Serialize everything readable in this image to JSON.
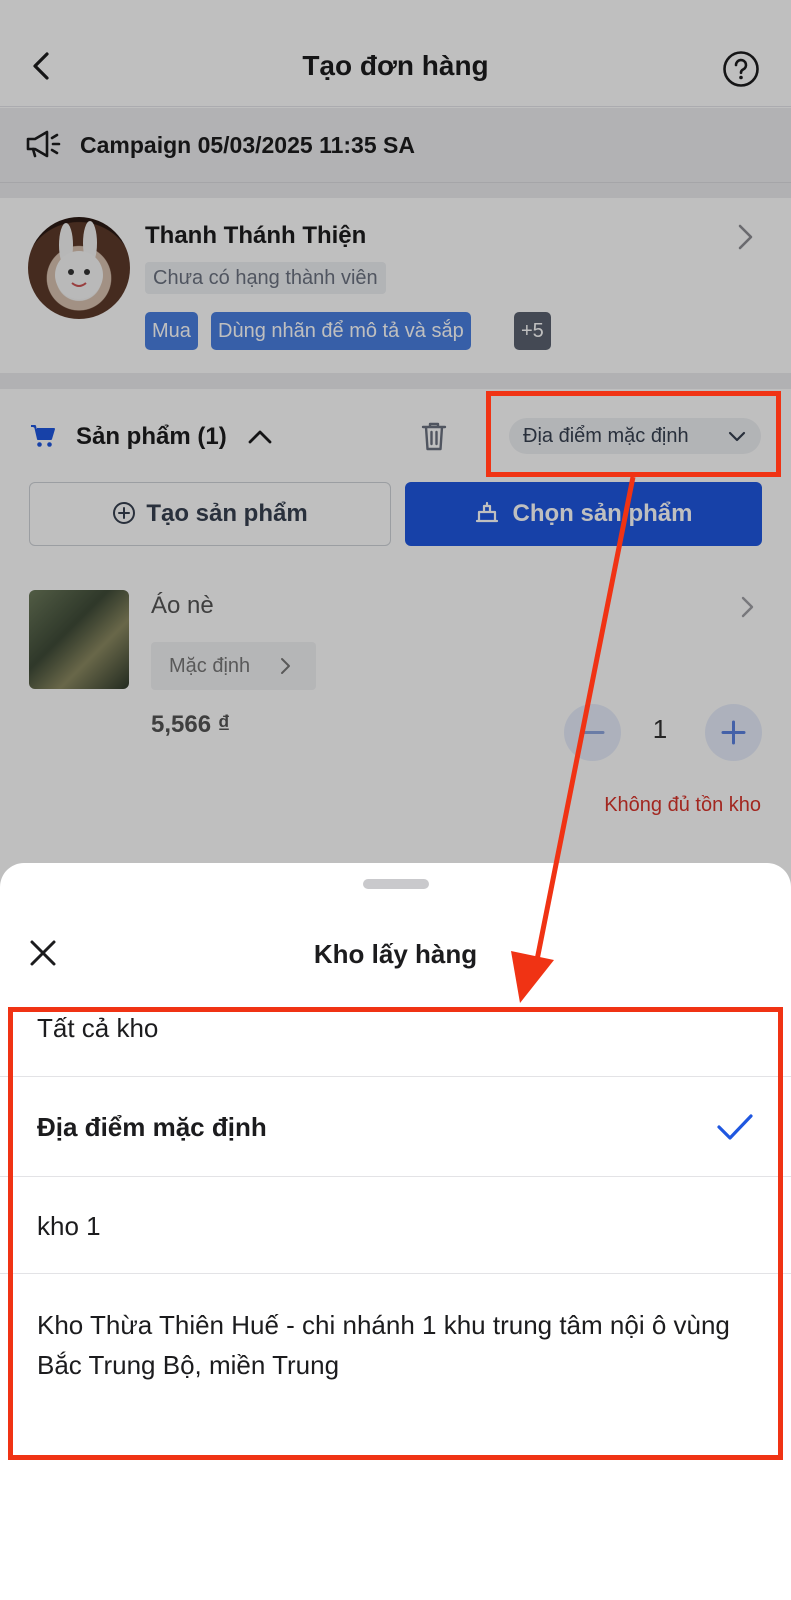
{
  "header": {
    "title": "Tạo đơn hàng"
  },
  "campaign": {
    "label": "Campaign 05/03/2025 11:35 SA"
  },
  "customer": {
    "name": "Thanh Thánh Thiện",
    "rank": "Chưa có hạng thành viên",
    "tags": [
      "Mua",
      "Dùng nhãn để mô tả và sắp",
      "+5"
    ]
  },
  "products": {
    "title": "Sản phẩm (1)",
    "location_dropdown": "Địa điểm mặc định",
    "create_button": "Tạo sản phẩm",
    "choose_button": "Chọn sản phẩm",
    "item": {
      "name": "Áo nè",
      "variant": "Mặc định",
      "price": "5,566 ₫",
      "quantity": "1",
      "warning": "Không đủ tồn kho"
    }
  },
  "sheet": {
    "title": "Kho lấy hàng",
    "options": [
      {
        "label": "Tất cả kho",
        "selected": false
      },
      {
        "label": "Địa điểm mặc định",
        "selected": true
      },
      {
        "label": "kho 1",
        "selected": false
      },
      {
        "label": "Kho Thừa Thiên Huế - chi nhánh 1 khu trung tâm nội ô vùng Bắc Trung Bộ, miền Trung",
        "selected": false
      }
    ]
  },
  "colors": {
    "primary": "#1f57e0",
    "tag_blue": "#4a7fe0",
    "tag_gray": "#5b6270",
    "warning": "#d9342b",
    "annotation": "#f03314"
  }
}
